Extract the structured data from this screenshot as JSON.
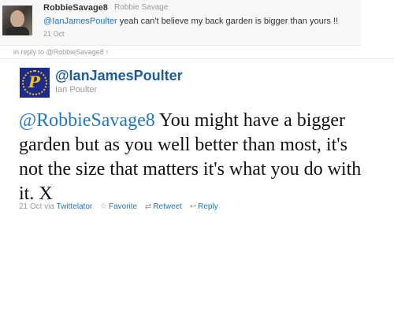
{
  "reply_tweet": {
    "screen_name": "RobbieSavage8",
    "full_name": "Robbie Savage",
    "mention": "@IanJamesPoulter",
    "text": " yeah can't believe my back garden is bigger than yours !!",
    "timestamp": "21 Oct"
  },
  "in_reply_to": {
    "label": "in reply to @RobbieSavage8",
    "arrow": "↑"
  },
  "main_tweet": {
    "screen_name": "@IanJamesPoulter",
    "full_name": "Ian Poulter",
    "mention": "@RobbieSavage8",
    "text": " You might have a bigger garden but as you well better than most, it's not the size that matters it's what you do with it. X",
    "timestamp": "21 Oct",
    "via_label": "via",
    "source": "Twittelator",
    "actions": {
      "favorite": "Favorite",
      "retweet": "Retweet",
      "reply": "Reply"
    },
    "action_icons": {
      "favorite": "star-icon",
      "retweet": "retweet-icon",
      "reply": "reply-arrow-icon"
    }
  },
  "colors": {
    "link": "#2276bb",
    "screen_name": "#1b5c97",
    "muted": "#999999"
  }
}
